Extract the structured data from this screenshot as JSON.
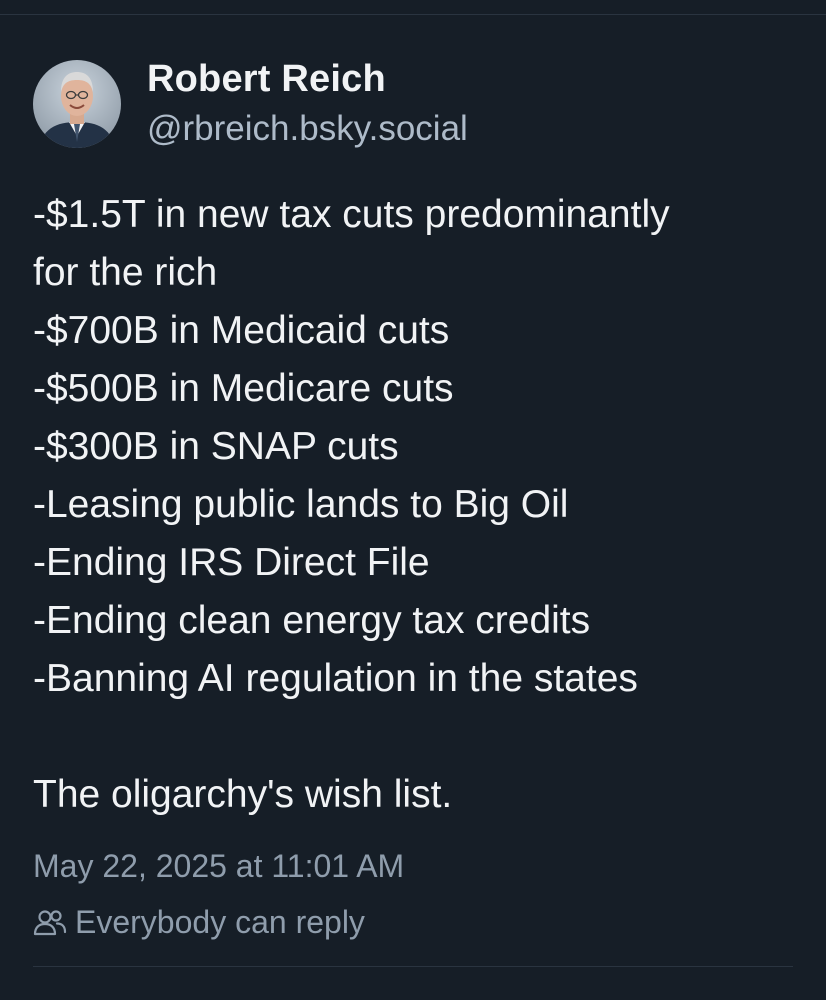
{
  "post": {
    "author": {
      "display_name": "Robert Reich",
      "handle": "@rbreich.bsky.social"
    },
    "body_lines": [
      "-$1.5T in new tax cuts predominantly",
      "for the rich",
      "-$700B in Medicaid cuts",
      "-$500B in Medicare cuts",
      "-$300B in SNAP cuts",
      "-Leasing public lands to Big Oil",
      "-Ending IRS Direct File",
      "-Ending clean energy tax credits",
      "-Banning AI regulation in the states"
    ],
    "closing_line": "The oligarchy's wish list.",
    "timestamp": "May 22, 2025 at 11:01 AM",
    "reply_setting": "Everybody can reply",
    "reply_icon": "people-icon"
  },
  "colors": {
    "background": "#161e27",
    "text": "#f1f3f5",
    "muted": "#8f9dac",
    "handle": "#aebbc9",
    "divider": "#2a3440"
  }
}
